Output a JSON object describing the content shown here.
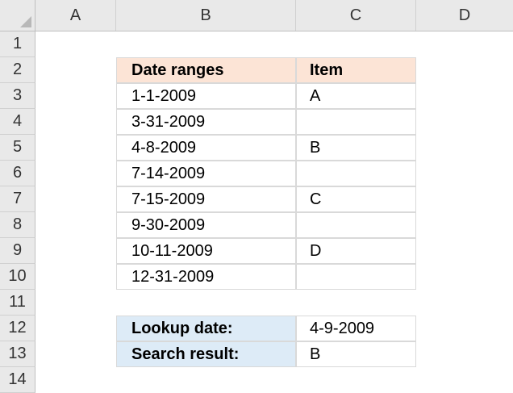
{
  "spreadsheet": {
    "columns": [
      "A",
      "B",
      "C",
      "D"
    ],
    "rows": [
      "1",
      "2",
      "3",
      "4",
      "5",
      "6",
      "7",
      "8",
      "9",
      "10",
      "11",
      "12",
      "13",
      "14"
    ]
  },
  "table": {
    "header": {
      "date": "Date ranges",
      "item": "Item"
    },
    "rows": [
      {
        "date": "1-1-2009",
        "item": "A"
      },
      {
        "date": "3-31-2009",
        "item": ""
      },
      {
        "date": "4-8-2009",
        "item": "B"
      },
      {
        "date": "7-14-2009",
        "item": ""
      },
      {
        "date": "7-15-2009",
        "item": "C"
      },
      {
        "date": "9-30-2009",
        "item": ""
      },
      {
        "date": "10-11-2009",
        "item": "D"
      },
      {
        "date": "12-31-2009",
        "item": ""
      }
    ]
  },
  "lookup": {
    "date_label": "Lookup date:",
    "date_value": "4-9-2009",
    "result_label": "Search result:",
    "result_value": "B"
  },
  "colors": {
    "header_bg": "#e9e9e9",
    "table_header_fill": "#fce4d6",
    "lookup_label_fill": "#ddebf7",
    "cell_border": "#d9d9d9"
  }
}
